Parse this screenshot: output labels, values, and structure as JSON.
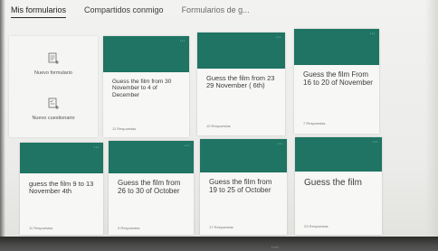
{
  "tabs": [
    {
      "label": "Mis formularios"
    },
    {
      "label": "Compartidos conmigo"
    },
    {
      "label": "Formularios de g..."
    }
  ],
  "new_panel": {
    "new_form_label": "Nuevo formulario",
    "new_quiz_label": "Nuevo cuestionario"
  },
  "cards": [
    {
      "title": "Guess the film from 30 November to 4 of December",
      "responses": "11 Respuestas"
    },
    {
      "title": "Guess the film from 23 29 November ( 6th)",
      "responses": "10 Respuestas"
    },
    {
      "title": "Guess the film From 16 to 20 of November",
      "responses": "7 Respuestas"
    },
    {
      "title": "guess the film 9 to 13 November 4th",
      "responses": "11 Respuestas"
    },
    {
      "title": "Guess the film from 26 to 30 of October",
      "responses": "9 Respuestas"
    },
    {
      "title": "Guess the film from 19 to 25 of October",
      "responses": "17 Respuestas"
    },
    {
      "title": "Guess the film",
      "responses": "23 Respuestas"
    }
  ],
  "card_menu_glyph": "···",
  "footer_text": "Leer",
  "colors": {
    "header": "#1f7463",
    "screen": "#f0f0ee",
    "bezel": "#2b2b2a"
  }
}
